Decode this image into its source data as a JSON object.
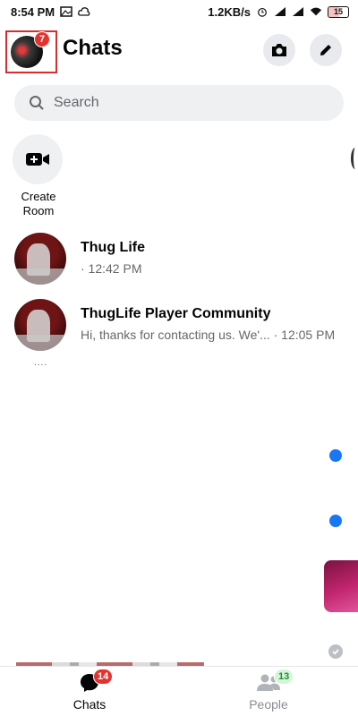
{
  "status_bar": {
    "time": "8:54 PM",
    "network_speed": "1.2KB/s",
    "battery": "15"
  },
  "header": {
    "title": "Chats",
    "avatar_badge": "7"
  },
  "search": {
    "placeholder": "Search"
  },
  "create_room": {
    "label": "Create Room"
  },
  "chats": [
    {
      "name": "Thug Life",
      "preview": "",
      "time": "· 12:42 PM"
    },
    {
      "name": "ThugLife Player Community",
      "preview": "Hi, thanks for contacting us. We'...",
      "time": "· 12:05 PM"
    }
  ],
  "below_dots": "....",
  "bottom_nav": {
    "chats_label": "Chats",
    "chats_badge": "14",
    "people_label": "People",
    "people_badge": "13"
  },
  "colors": {
    "accent": "#1877f2",
    "badge_red": "#e4332f",
    "highlight_box": "#d32f2f"
  }
}
